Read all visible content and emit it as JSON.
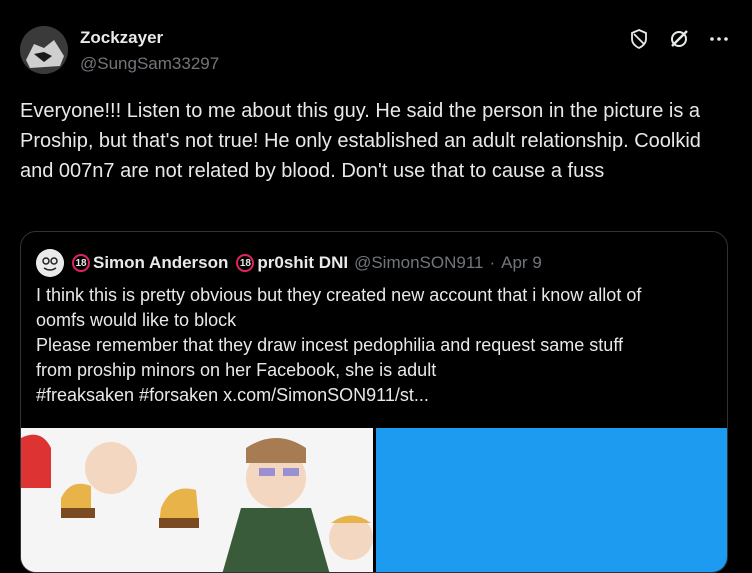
{
  "author": {
    "name": "Zockzayer",
    "handle": "@SungSam33297"
  },
  "icons": [
    "shield-icon",
    "grok-icon",
    "more-icon"
  ],
  "tweet": {
    "text": "Everyone!!! Listen to me about this guy. He said the person in the picture is a Proship, but that's not true! He only established an adult relationship. Coolkid and 007n7 are not related by blood. Don't use that to cause a fuss"
  },
  "quoted": {
    "badge": "18",
    "name_part1": "Simon Anderson",
    "name_part2": "pr0shit DNI",
    "handle": "@SimonSON911",
    "separator": "·",
    "date": "Apr 9",
    "lines": [
      "I think this is pretty obvious but they created new account that i know allot of",
      "oomfs would like to block",
      "Please remember that they draw incest pedophilia and request same stuff",
      "from proship minors on her Facebook, she is adult",
      "#freaksaken #forsaken  x.com/SimonSON911/st..."
    ]
  },
  "colors": {
    "background": "#000000",
    "text": "#e7e9ea",
    "muted": "#71767b",
    "border": "#2f3336",
    "media_blue": "#1d9bf0"
  }
}
